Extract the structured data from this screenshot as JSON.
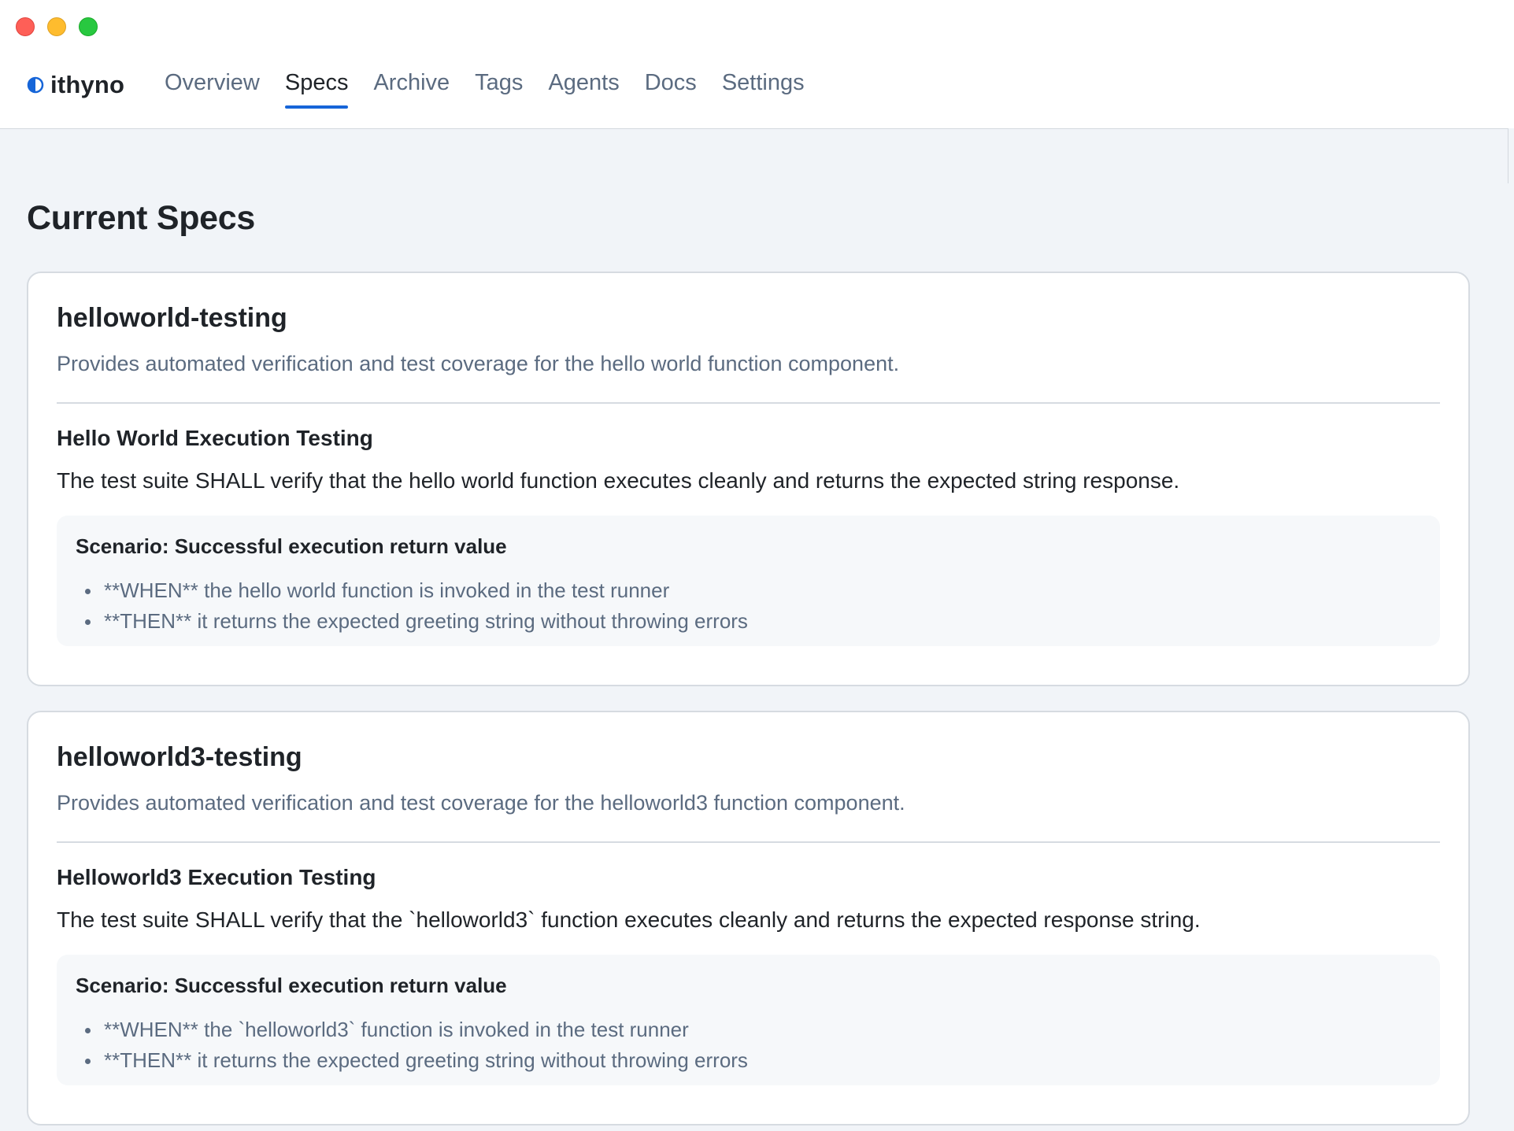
{
  "app": {
    "name": "ithyno",
    "accent_color": "#1665d8"
  },
  "window_controls": [
    "close",
    "minimize",
    "zoom"
  ],
  "nav": {
    "tabs": [
      {
        "label": "Overview",
        "active": false
      },
      {
        "label": "Specs",
        "active": true
      },
      {
        "label": "Archive",
        "active": false
      },
      {
        "label": "Tags",
        "active": false
      },
      {
        "label": "Agents",
        "active": false
      },
      {
        "label": "Docs",
        "active": false
      },
      {
        "label": "Settings",
        "active": false
      }
    ]
  },
  "page": {
    "title": "Current Specs"
  },
  "specs": [
    {
      "name": "helloworld-testing",
      "description": "Provides automated verification and test coverage for the hello world function component.",
      "requirement": {
        "title": "Hello World Execution Testing",
        "text": "The test suite SHALL verify that the hello world function executes cleanly and returns the expected string response."
      },
      "scenario": {
        "title": "Scenario: Successful execution return value",
        "steps": [
          "**WHEN** the hello world function is invoked in the test runner",
          "**THEN** it returns the expected greeting string without throwing errors"
        ]
      }
    },
    {
      "name": "helloworld3-testing",
      "description": "Provides automated verification and test coverage for the helloworld3 function component.",
      "requirement": {
        "title": "Helloworld3 Execution Testing",
        "text": "The test suite SHALL verify that the `helloworld3` function executes cleanly and returns the expected response string."
      },
      "scenario": {
        "title": "Scenario: Successful execution return value",
        "steps": [
          "**WHEN** the `helloworld3` function is invoked in the test runner",
          "**THEN** it returns the expected greeting string without throwing errors"
        ]
      }
    }
  ]
}
